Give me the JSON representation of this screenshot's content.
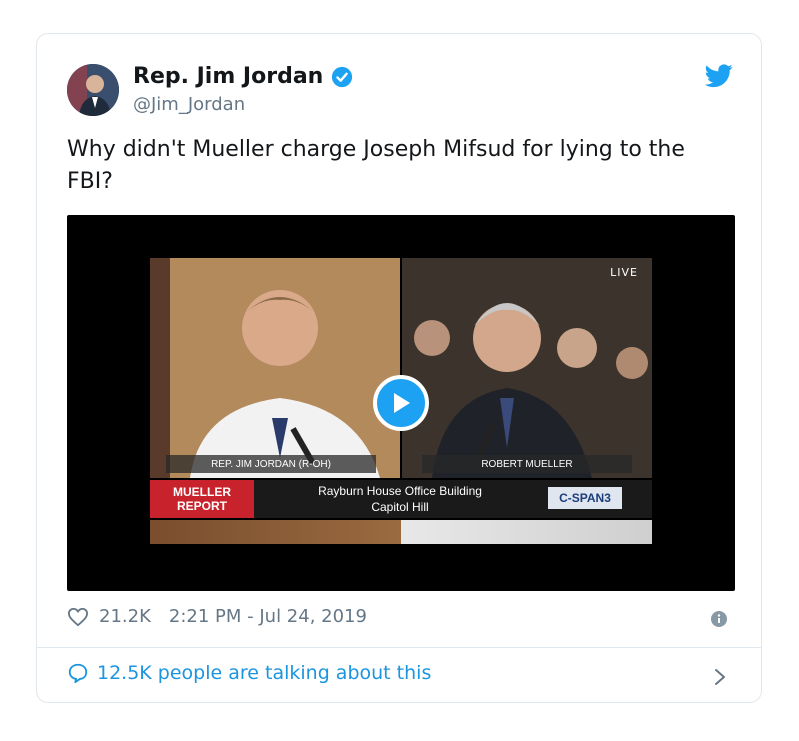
{
  "tweet": {
    "author_name": "Rep. Jim Jordan",
    "author_handle": "@Jim_Jordan",
    "text": "Why didn't Mueller charge Joseph Mifsud for lying to the FBI?",
    "likes": "21.2K",
    "timestamp": "2:21 PM - Jul 24, 2019",
    "talking": "12.5K people are talking about this"
  },
  "video": {
    "live_label": "LIVE",
    "left_caption": "REP. JIM JORDAN (R-OH)",
    "right_caption": "ROBERT MUELLER",
    "badge_line1": "MUELLER",
    "badge_line2": "REPORT",
    "location_line1": "Rayburn House Office Building",
    "location_line2": "Capitol Hill",
    "network": "C-SPAN3"
  },
  "icons": {
    "verified": "verified-badge-icon",
    "bird": "twitter-bird-icon",
    "heart": "heart-icon",
    "info": "info-icon",
    "comment": "comment-bubble-icon",
    "chevron": "chevron-right-icon",
    "play": "play-icon"
  },
  "colors": {
    "accent": "#1da1f2",
    "link": "#1b95e0",
    "muted": "#657786",
    "badge_red": "#c8232c"
  }
}
